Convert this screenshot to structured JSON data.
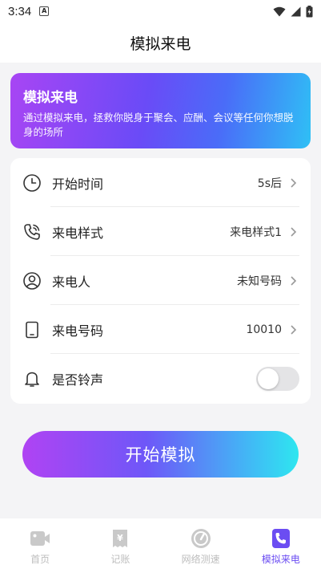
{
  "status_bar": {
    "time": "3:34",
    "notification_letter": "A"
  },
  "header": {
    "title": "模拟来电"
  },
  "banner": {
    "title": "模拟来电",
    "description": "通过模拟来电，拯救你脱身于聚会、应酬、会议等任何你想脱身的场所"
  },
  "settings": {
    "start_time": {
      "label": "开始时间",
      "value": "5s后",
      "icon": "clock-icon"
    },
    "call_style": {
      "label": "来电样式",
      "value": "来电样式1",
      "icon": "phone-call-icon"
    },
    "caller": {
      "label": "来电人",
      "value": "未知号码",
      "icon": "user-icon"
    },
    "caller_number": {
      "label": "来电号码",
      "value": "10010",
      "icon": "mobile-icon"
    },
    "ringtone": {
      "label": "是否铃声",
      "enabled": false,
      "icon": "bell-icon"
    }
  },
  "start_button": {
    "label": "开始模拟"
  },
  "tabs": [
    {
      "label": "首页",
      "icon": "video-icon",
      "active": false
    },
    {
      "label": "记账",
      "icon": "ledger-icon",
      "active": false
    },
    {
      "label": "网络测速",
      "icon": "speedometer-icon",
      "active": false
    },
    {
      "label": "模拟来电",
      "icon": "incoming-call-icon",
      "active": true
    }
  ],
  "colors": {
    "accent": "#6b4df2",
    "gradient_start": "#a845f4",
    "gradient_end": "#2fc0f5",
    "tab_inactive": "#bdbdbd"
  }
}
